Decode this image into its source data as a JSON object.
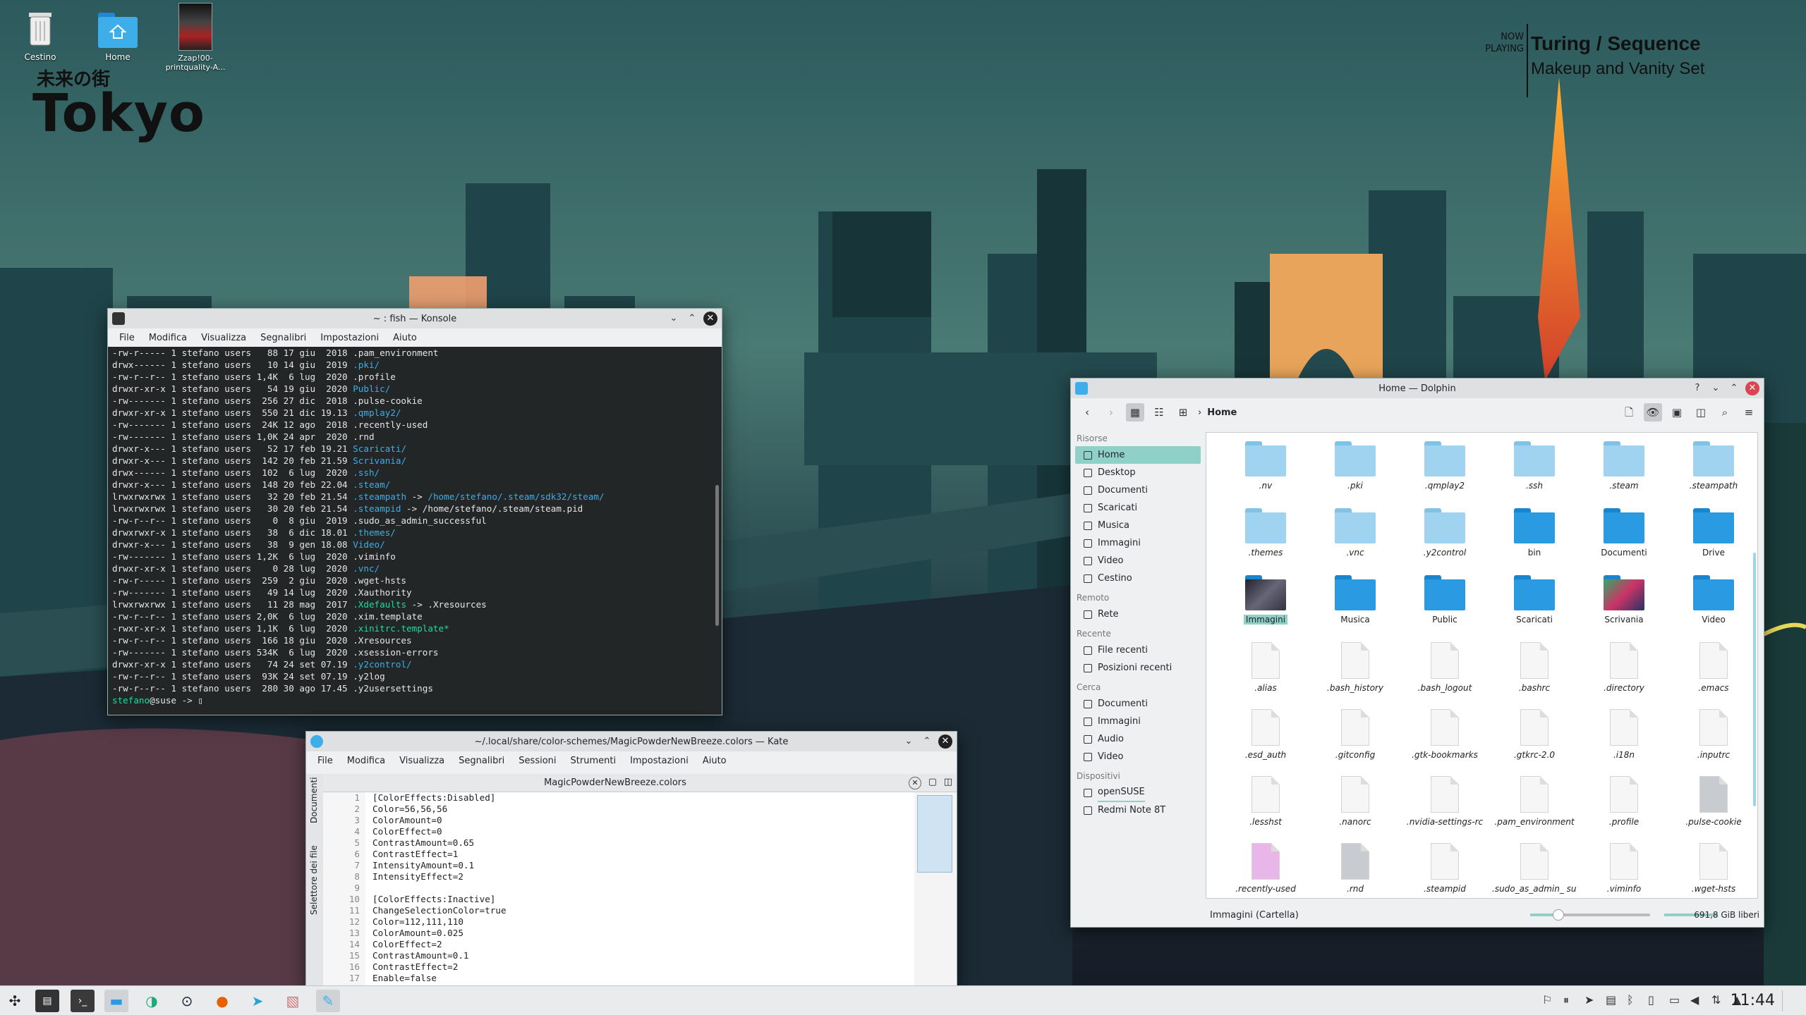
{
  "desktop": {
    "icons": [
      {
        "label": "Cestino",
        "icon": "trash-icon"
      },
      {
        "label": "Home",
        "icon": "home-folder-icon"
      },
      {
        "label": "Zzap!00-printquality-A...",
        "icon": "image-thumbnail-icon"
      }
    ],
    "widget_jp": "未来の街",
    "widget_title": "Tokyo",
    "now_playing_label": "NOW PLAYING",
    "now_playing_title": "Turing / Sequence",
    "now_playing_album": "Makeup and Vanity Set"
  },
  "konsole": {
    "title": "~ : fish — Konsole",
    "menu": [
      "File",
      "Modifica",
      "Visualizza",
      "Segnalibri",
      "Impostazioni",
      "Aiuto"
    ],
    "lines": [
      {
        "t": "-rw-r----- 1 stefano users   88 17 giu  2018 .pam_environment",
        "c": ""
      },
      {
        "t": "drwx------ 1 stefano users   10 14 giu  2019 ",
        "c": "",
        "d": ".pki/"
      },
      {
        "t": "-rw-r--r-- 1 stefano users 1,4K  6 lug  2020 .profile",
        "c": ""
      },
      {
        "t": "drwxr-xr-x 1 stefano users   54 19 giu  2020 ",
        "c": "",
        "d": "Public/"
      },
      {
        "t": "-rw------- 1 stefano users  256 27 dic  2018 .pulse-cookie",
        "c": ""
      },
      {
        "t": "drwxr-xr-x 1 stefano users  550 21 dic 19.13 ",
        "c": "",
        "d": ".qmplay2/"
      },
      {
        "t": "-rw------- 1 stefano users  24K 12 ago  2018 .recently-used",
        "c": ""
      },
      {
        "t": "-rw------- 1 stefano users 1,0K 24 apr  2020 .rnd",
        "c": ""
      },
      {
        "t": "drwxr-x--- 1 stefano users   52 17 feb 19.21 ",
        "c": "",
        "d": "Scaricati/"
      },
      {
        "t": "drwxr-x--- 1 stefano users  142 20 feb 21.59 ",
        "c": "",
        "d": "Scrivania/"
      },
      {
        "t": "drwx------ 1 stefano users  102  6 lug  2020 ",
        "c": "",
        "d": ".ssh/"
      },
      {
        "t": "drwxr-x--- 1 stefano users  148 20 feb 22.04 ",
        "c": "",
        "d": ".steam/"
      },
      {
        "t": "lrwxrwxrwx 1 stefano users   32 20 feb 21.54 ",
        "c": "",
        "d": ".steampath",
        "r": " -> ",
        "d2": "/home/stefano/.steam/sdk32/steam/"
      },
      {
        "t": "lrwxrwxrwx 1 stefano users   30 20 feb 21.54 ",
        "c": "",
        "d": ".steampid",
        "r": " -> /home/stefano/.steam/steam.pid"
      },
      {
        "t": "-rw-r--r-- 1 stefano users    0  8 giu  2019 .sudo_as_admin_successful",
        "c": ""
      },
      {
        "t": "drwxrwxr-x 1 stefano users   38  6 dic 18.01 ",
        "c": "",
        "d": ".themes/"
      },
      {
        "t": "drwxr-x--- 1 stefano users   38  9 gen 18.08 ",
        "c": "",
        "d": "Video/"
      },
      {
        "t": "-rw------- 1 stefano users 1,2K  6 lug  2020 .viminfo",
        "c": ""
      },
      {
        "t": "drwxr-xr-x 1 stefano users    0 28 lug  2020 ",
        "c": "",
        "d": ".vnc/"
      },
      {
        "t": "-rw-r----- 1 stefano users  259  2 giu  2020 .wget-hsts",
        "c": ""
      },
      {
        "t": "-rw------- 1 stefano users   49 14 lug  2020 .Xauthority",
        "c": ""
      },
      {
        "t": "lrwxrwxrwx 1 stefano users   11 28 mag  2017 ",
        "c": "",
        "g": ".Xdefaults",
        "r": " -> .Xresources"
      },
      {
        "t": "-rw-r--r-- 1 stefano users 2,0K  6 lug  2020 .xim.template",
        "c": ""
      },
      {
        "t": "-rwxr-xr-x 1 stefano users 1,1K  6 lug  2020 ",
        "c": "",
        "g": ".xinitrc.template*"
      },
      {
        "t": "-rw-r--r-- 1 stefano users  166 18 giu  2020 .Xresources",
        "c": ""
      },
      {
        "t": "-rw------- 1 stefano users 534K  6 lug  2020 .xsession-errors",
        "c": ""
      },
      {
        "t": "drwxr-xr-x 1 stefano users   74 24 set 07.19 ",
        "c": "",
        "d": ".y2control/"
      },
      {
        "t": "-rw-r--r-- 1 stefano users  93K 24 set 07.19 .y2log",
        "c": ""
      },
      {
        "t": "-rw-r--r-- 1 stefano users  280 30 ago 17.45 .y2usersettings",
        "c": ""
      }
    ],
    "prompt_user": "stefano",
    "prompt_host": "@suse ->"
  },
  "kate": {
    "title": "~/.local/share/color-schemes/MagicPowderNewBreeze.colors — Kate",
    "menu": [
      "File",
      "Modifica",
      "Visualizza",
      "Segnalibri",
      "Sessioni",
      "Strumenti",
      "Impostazioni",
      "Aiuto"
    ],
    "tab": "MagicPowderNewBreeze.colors",
    "side_labels": [
      "Documenti",
      "Selettore dei file"
    ],
    "line_numbers": "1\n2\n3\n4\n5\n6\n7\n8\n9\n10\n11\n12\n13\n14\n15\n16\n17",
    "code": "[ColorEffects:Disabled]\nColor=56,56,56\nColorAmount=0\nColorEffect=0\nContrastAmount=0.65\nContrastEffect=1\nIntensityAmount=0.1\nIntensityEffect=2\n\n[ColorEffects:Inactive]\nChangeSelectionColor=true\nColor=112,111,110\nColorAmount=0.025\nColorEffect=2\nContrastAmount=0.1\nContrastEffect=2\nEnable=false"
  },
  "dolphin": {
    "title": "Home — Dolphin",
    "breadcrumb": "Home",
    "sidebar": [
      {
        "section": "Risorse",
        "items": [
          "Home",
          "Desktop",
          "Documenti",
          "Scaricati",
          "Musica",
          "Immagini",
          "Video",
          "Cestino"
        ]
      },
      {
        "section": "Remoto",
        "items": [
          "Rete"
        ]
      },
      {
        "section": "Recente",
        "items": [
          "File recenti",
          "Posizioni recenti"
        ]
      },
      {
        "section": "Cerca",
        "items": [
          "Documenti",
          "Immagini",
          "Audio",
          "Video"
        ]
      },
      {
        "section": "Dispositivi",
        "items": [
          "openSUSE",
          "Redmi Note 8T"
        ]
      }
    ],
    "files": [
      {
        "name": ".nv",
        "kind": "folder"
      },
      {
        "name": ".pki",
        "kind": "folder"
      },
      {
        "name": ".qmplay2",
        "kind": "folder"
      },
      {
        "name": ".ssh",
        "kind": "folder"
      },
      {
        "name": ".steam",
        "kind": "folder"
      },
      {
        "name": ".steampath",
        "kind": "folder-link"
      },
      {
        "name": ".themes",
        "kind": "folder"
      },
      {
        "name": ".vnc",
        "kind": "folder"
      },
      {
        "name": ".y2control",
        "kind": "folder"
      },
      {
        "name": "bin",
        "kind": "folder-blue"
      },
      {
        "name": "Documenti",
        "kind": "folder-blue"
      },
      {
        "name": "Drive",
        "kind": "folder-blue"
      },
      {
        "name": "Immagini",
        "kind": "folder-img"
      },
      {
        "name": "Musica",
        "kind": "folder-blue"
      },
      {
        "name": "Public",
        "kind": "folder-blue"
      },
      {
        "name": "Scaricati",
        "kind": "folder-blue"
      },
      {
        "name": "Scrivania",
        "kind": "folder-img2"
      },
      {
        "name": "Video",
        "kind": "folder-blue"
      },
      {
        "name": ".alias",
        "kind": "file"
      },
      {
        "name": ".bash_history",
        "kind": "file"
      },
      {
        "name": ".bash_logout",
        "kind": "file"
      },
      {
        "name": ".bashrc",
        "kind": "file"
      },
      {
        "name": ".directory",
        "kind": "file"
      },
      {
        "name": ".emacs",
        "kind": "file"
      },
      {
        "name": ".esd_auth",
        "kind": "file"
      },
      {
        "name": ".gitconfig",
        "kind": "file"
      },
      {
        "name": ".gtk-bookmarks",
        "kind": "file"
      },
      {
        "name": ".gtkrc-2.0",
        "kind": "file"
      },
      {
        "name": ".i18n",
        "kind": "file"
      },
      {
        "name": ".inputrc",
        "kind": "file"
      },
      {
        "name": ".lesshst",
        "kind": "file"
      },
      {
        "name": ".nanorc",
        "kind": "file"
      },
      {
        "name": ".nvidia-settings-rc",
        "kind": "file"
      },
      {
        "name": ".pam_environment",
        "kind": "file"
      },
      {
        "name": ".profile",
        "kind": "file"
      },
      {
        "name": ".pulse-cookie",
        "kind": "file-unknown"
      },
      {
        "name": ".recently-used",
        "kind": "file-code"
      },
      {
        "name": ".rnd",
        "kind": "file-unknown"
      },
      {
        "name": ".steampid",
        "kind": "file"
      },
      {
        "name": ".sudo_as_admin_ successful",
        "kind": "file"
      },
      {
        "name": ".viminfo",
        "kind": "file"
      },
      {
        "name": ".wget-hsts",
        "kind": "file"
      }
    ],
    "status_left": "Immagini (Cartella)",
    "status_free": "691,8 GiB liberi"
  },
  "taskbar": {
    "clock": "11:44"
  },
  "colors": {
    "folder_light": "#9fd3ef",
    "folder_blue": "#2a9ae3",
    "selection": "#8fd0c8",
    "terminal_bg": "#232627",
    "dir_color": "#3daee9",
    "exec_color": "#1cdc9a"
  }
}
